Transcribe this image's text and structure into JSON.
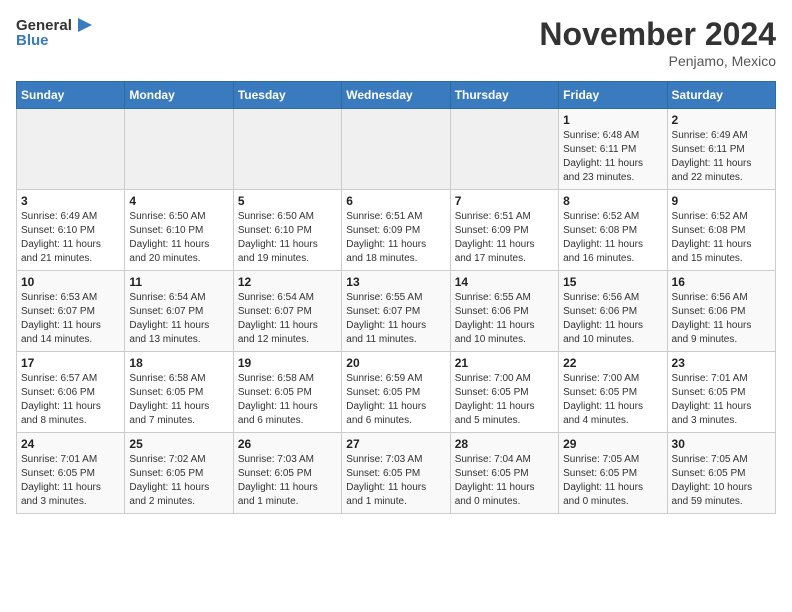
{
  "header": {
    "logo_line1": "General",
    "logo_line2": "Blue",
    "month": "November 2024",
    "location": "Penjamo, Mexico"
  },
  "weekdays": [
    "Sunday",
    "Monday",
    "Tuesday",
    "Wednesday",
    "Thursday",
    "Friday",
    "Saturday"
  ],
  "weeks": [
    [
      {
        "day": "",
        "info": ""
      },
      {
        "day": "",
        "info": ""
      },
      {
        "day": "",
        "info": ""
      },
      {
        "day": "",
        "info": ""
      },
      {
        "day": "",
        "info": ""
      },
      {
        "day": "1",
        "info": "Sunrise: 6:48 AM\nSunset: 6:11 PM\nDaylight: 11 hours\nand 23 minutes."
      },
      {
        "day": "2",
        "info": "Sunrise: 6:49 AM\nSunset: 6:11 PM\nDaylight: 11 hours\nand 22 minutes."
      }
    ],
    [
      {
        "day": "3",
        "info": "Sunrise: 6:49 AM\nSunset: 6:10 PM\nDaylight: 11 hours\nand 21 minutes."
      },
      {
        "day": "4",
        "info": "Sunrise: 6:50 AM\nSunset: 6:10 PM\nDaylight: 11 hours\nand 20 minutes."
      },
      {
        "day": "5",
        "info": "Sunrise: 6:50 AM\nSunset: 6:10 PM\nDaylight: 11 hours\nand 19 minutes."
      },
      {
        "day": "6",
        "info": "Sunrise: 6:51 AM\nSunset: 6:09 PM\nDaylight: 11 hours\nand 18 minutes."
      },
      {
        "day": "7",
        "info": "Sunrise: 6:51 AM\nSunset: 6:09 PM\nDaylight: 11 hours\nand 17 minutes."
      },
      {
        "day": "8",
        "info": "Sunrise: 6:52 AM\nSunset: 6:08 PM\nDaylight: 11 hours\nand 16 minutes."
      },
      {
        "day": "9",
        "info": "Sunrise: 6:52 AM\nSunset: 6:08 PM\nDaylight: 11 hours\nand 15 minutes."
      }
    ],
    [
      {
        "day": "10",
        "info": "Sunrise: 6:53 AM\nSunset: 6:07 PM\nDaylight: 11 hours\nand 14 minutes."
      },
      {
        "day": "11",
        "info": "Sunrise: 6:54 AM\nSunset: 6:07 PM\nDaylight: 11 hours\nand 13 minutes."
      },
      {
        "day": "12",
        "info": "Sunrise: 6:54 AM\nSunset: 6:07 PM\nDaylight: 11 hours\nand 12 minutes."
      },
      {
        "day": "13",
        "info": "Sunrise: 6:55 AM\nSunset: 6:07 PM\nDaylight: 11 hours\nand 11 minutes."
      },
      {
        "day": "14",
        "info": "Sunrise: 6:55 AM\nSunset: 6:06 PM\nDaylight: 11 hours\nand 10 minutes."
      },
      {
        "day": "15",
        "info": "Sunrise: 6:56 AM\nSunset: 6:06 PM\nDaylight: 11 hours\nand 10 minutes."
      },
      {
        "day": "16",
        "info": "Sunrise: 6:56 AM\nSunset: 6:06 PM\nDaylight: 11 hours\nand 9 minutes."
      }
    ],
    [
      {
        "day": "17",
        "info": "Sunrise: 6:57 AM\nSunset: 6:06 PM\nDaylight: 11 hours\nand 8 minutes."
      },
      {
        "day": "18",
        "info": "Sunrise: 6:58 AM\nSunset: 6:05 PM\nDaylight: 11 hours\nand 7 minutes."
      },
      {
        "day": "19",
        "info": "Sunrise: 6:58 AM\nSunset: 6:05 PM\nDaylight: 11 hours\nand 6 minutes."
      },
      {
        "day": "20",
        "info": "Sunrise: 6:59 AM\nSunset: 6:05 PM\nDaylight: 11 hours\nand 6 minutes."
      },
      {
        "day": "21",
        "info": "Sunrise: 7:00 AM\nSunset: 6:05 PM\nDaylight: 11 hours\nand 5 minutes."
      },
      {
        "day": "22",
        "info": "Sunrise: 7:00 AM\nSunset: 6:05 PM\nDaylight: 11 hours\nand 4 minutes."
      },
      {
        "day": "23",
        "info": "Sunrise: 7:01 AM\nSunset: 6:05 PM\nDaylight: 11 hours\nand 3 minutes."
      }
    ],
    [
      {
        "day": "24",
        "info": "Sunrise: 7:01 AM\nSunset: 6:05 PM\nDaylight: 11 hours\nand 3 minutes."
      },
      {
        "day": "25",
        "info": "Sunrise: 7:02 AM\nSunset: 6:05 PM\nDaylight: 11 hours\nand 2 minutes."
      },
      {
        "day": "26",
        "info": "Sunrise: 7:03 AM\nSunset: 6:05 PM\nDaylight: 11 hours\nand 1 minute."
      },
      {
        "day": "27",
        "info": "Sunrise: 7:03 AM\nSunset: 6:05 PM\nDaylight: 11 hours\nand 1 minute."
      },
      {
        "day": "28",
        "info": "Sunrise: 7:04 AM\nSunset: 6:05 PM\nDaylight: 11 hours\nand 0 minutes."
      },
      {
        "day": "29",
        "info": "Sunrise: 7:05 AM\nSunset: 6:05 PM\nDaylight: 11 hours\nand 0 minutes."
      },
      {
        "day": "30",
        "info": "Sunrise: 7:05 AM\nSunset: 6:05 PM\nDaylight: 10 hours\nand 59 minutes."
      }
    ]
  ]
}
